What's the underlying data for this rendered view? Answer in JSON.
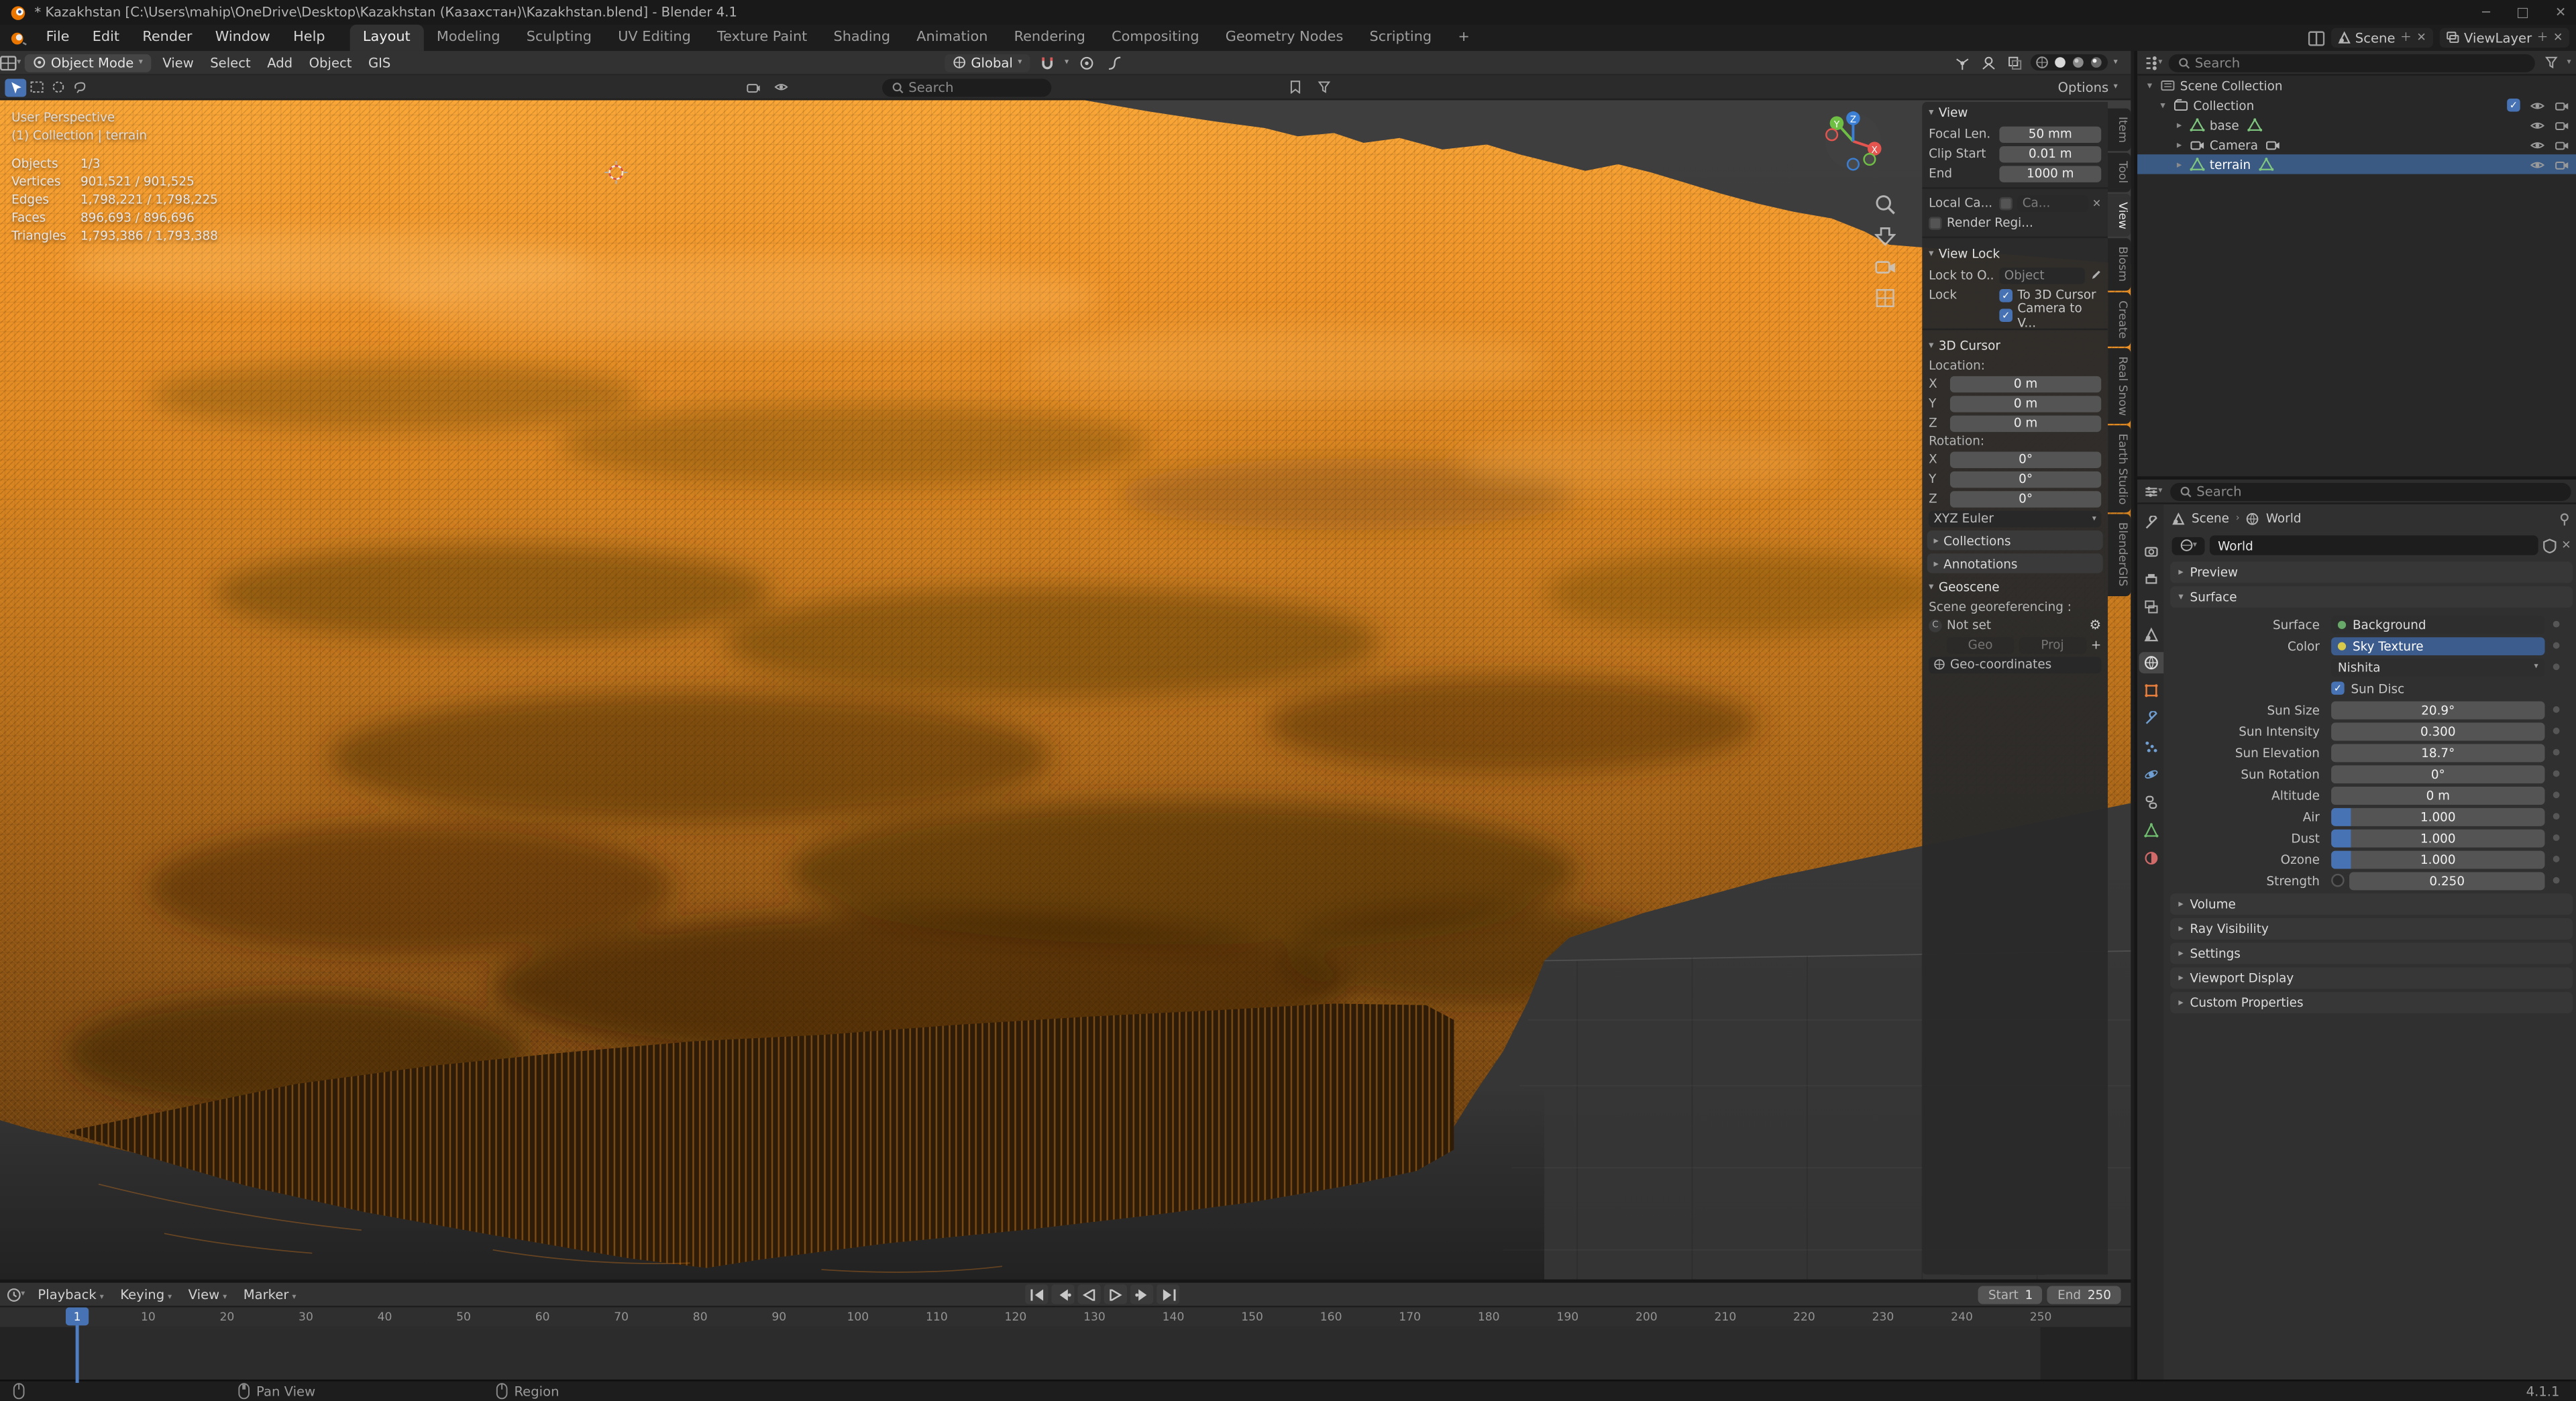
{
  "window": {
    "title": "* Kazakhstan [C:\\Users\\mahip\\OneDrive\\Desktop\\Kazakhstan (Казахстан)\\Kazakhstan.blend] - Blender 4.1",
    "controls": [
      "─",
      "□",
      "✕"
    ]
  },
  "topbar": {
    "menus": [
      "File",
      "Edit",
      "Render",
      "Window",
      "Help"
    ],
    "workspaces": [
      "Layout",
      "Modeling",
      "Sculpting",
      "UV Editing",
      "Texture Paint",
      "Shading",
      "Animation",
      "Rendering",
      "Compositing",
      "Geometry Nodes",
      "Scripting"
    ],
    "active_workspace": "Layout",
    "add_workspace": "+",
    "scene_label": "Scene",
    "view_layer_label": "ViewLayer"
  },
  "viewport": {
    "mode": "Object Mode",
    "menus": [
      "View",
      "Select",
      "Add",
      "Object",
      "GIS"
    ],
    "orientation": "Global",
    "search_placeholder": "Search",
    "options_label": "Options",
    "overlay": {
      "perspective": "User Perspective",
      "breadcrumb": "(1) Collection | terrain",
      "stats": [
        [
          "Objects",
          "1/3"
        ],
        [
          "Vertices",
          "901,521 / 901,525"
        ],
        [
          "Edges",
          "1,798,221 / 1,798,225"
        ],
        [
          "Faces",
          "896,693 / 896,696"
        ],
        [
          "Triangles",
          "1,793,386 / 1,793,388"
        ]
      ]
    },
    "gizmo_axes": [
      "X",
      "Y",
      "Z"
    ]
  },
  "sidebar": {
    "tabs": [
      "Item",
      "Tool",
      "View",
      "Blosm",
      "Create",
      "Real Snow",
      "Earth Studio",
      "BlenderGIS"
    ],
    "active_tab": "View",
    "view_panel": {
      "title": "View",
      "focal_label": "Focal Len.",
      "focal": "50 mm",
      "clip_start_label": "Clip Start",
      "clip_start": "0.01 m",
      "clip_end_label": "End",
      "clip_end": "1000 m",
      "local_camera_label": "Local Ca...",
      "local_camera_value": "Ca...",
      "render_region_label": "Render Regi..."
    },
    "view_lock_panel": {
      "title": "View Lock",
      "lock_to_label": "Lock to O...",
      "object_placeholder": "Object",
      "lock_label": "Lock",
      "to_3d_cursor": "To 3D Cursor",
      "camera_to_view": "Camera to V..."
    },
    "cursor_panel": {
      "title": "3D Cursor",
      "location_label": "Location:",
      "rotation_label": "Rotation:",
      "location": [
        [
          "X",
          "0 m"
        ],
        [
          "Y",
          "0 m"
        ],
        [
          "Z",
          "0 m"
        ]
      ],
      "rotation": [
        [
          "X",
          "0°"
        ],
        [
          "Y",
          "0°"
        ],
        [
          "Z",
          "0°"
        ]
      ],
      "rotation_order": "XYZ Euler"
    },
    "collections_panel": "Collections",
    "annotations_panel": "Annotations",
    "geoscene_panel": {
      "title": "Geoscene",
      "georef_label": "Scene georeferencing :",
      "crs_prefix": "C",
      "crs_value": "Not set",
      "geo_button": "Geo",
      "proj_button": "Proj",
      "add_button": "+",
      "geocoords_button": "Geo-coordinates"
    }
  },
  "outliner": {
    "search_placeholder": "Search",
    "root": "Scene Collection",
    "collection": "Collection",
    "items": [
      {
        "name": "base",
        "type": "mesh",
        "selected": false
      },
      {
        "name": "Camera",
        "type": "camera",
        "selected": false
      },
      {
        "name": "terrain",
        "type": "mesh",
        "selected": true
      }
    ]
  },
  "properties": {
    "search_placeholder": "Search",
    "breadcrumb": {
      "scene": "Scene",
      "world": "World"
    },
    "datablock": "World",
    "panels_top": [
      "Preview"
    ],
    "surface_panel": {
      "title": "Surface",
      "surface_label": "Surface",
      "surface_value": "Background",
      "color_label": "Color",
      "color_value": "Sky Texture",
      "sky_type": "Nishita",
      "sun_disc_label": "Sun Disc",
      "rows": [
        [
          "Sun Size",
          "20.9°"
        ],
        [
          "Sun Intensity",
          "0.300"
        ],
        [
          "Sun Elevation",
          "18.7°"
        ],
        [
          "Sun Rotation",
          "0°"
        ],
        [
          "Altitude",
          "0 m"
        ]
      ],
      "sliders": [
        [
          "Air",
          "1.000"
        ],
        [
          "Dust",
          "1.000"
        ],
        [
          "Ozone",
          "1.000"
        ]
      ],
      "strength_label": "Strength",
      "strength_value": "0.250"
    },
    "panels_bottom": [
      "Volume",
      "Ray Visibility",
      "Settings",
      "Viewport Display",
      "Custom Properties"
    ]
  },
  "timeline": {
    "menus": [
      "Playback",
      "Keying",
      "View",
      "Marker"
    ],
    "current_frame": "1",
    "start_label": "Start",
    "start": "1",
    "end_label": "End",
    "end": "250",
    "ruler": [
      10,
      20,
      30,
      40,
      50,
      60,
      70,
      80,
      90,
      100,
      110,
      120,
      130,
      140,
      150,
      160,
      170,
      180,
      190,
      200,
      210,
      220,
      230,
      240,
      250
    ]
  },
  "statusbar": {
    "pan_view": "Pan View",
    "region": "Region",
    "version": "4.1.1"
  },
  "colors": {
    "accent": "#4772b3",
    "selection_orange": "#f59a35",
    "mesh_icon_green": "#7fc77f"
  }
}
